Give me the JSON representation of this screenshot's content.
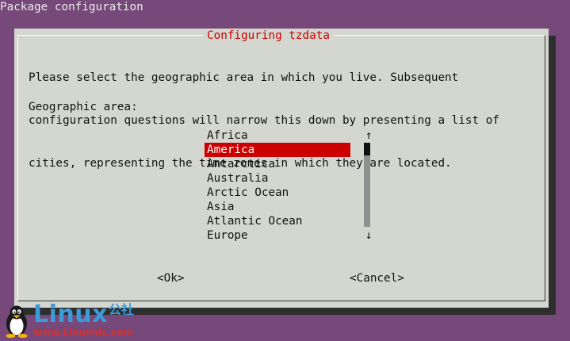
{
  "window": {
    "title": "Package configuration"
  },
  "dialog": {
    "title": "Configuring tzdata",
    "description": [
      "Please select the geographic area in which you live. Subsequent",
      "configuration questions will narrow this down by presenting a list of",
      "cities, representing the time zones in which they are located."
    ],
    "field_label": "Geographic area:",
    "areas": [
      "Africa",
      "America",
      "Antarctica",
      "Australia",
      "Arctic Ocean",
      "Asia",
      "Atlantic Ocean",
      "Europe"
    ],
    "selected": "America",
    "scroll_up": "↑",
    "scroll_down": "↓",
    "ok_label": "<Ok>",
    "cancel_label": "<Cancel>"
  },
  "watermark": {
    "logo_text": "Linux",
    "logo_cn": "公社",
    "url": "www.Linuxidc.com"
  },
  "colors": {
    "desktop_background": "#77487a",
    "dialog_background": "#d3d7cf",
    "accent_red": "#cc0000",
    "logo_blue": "#3d9ad8"
  }
}
